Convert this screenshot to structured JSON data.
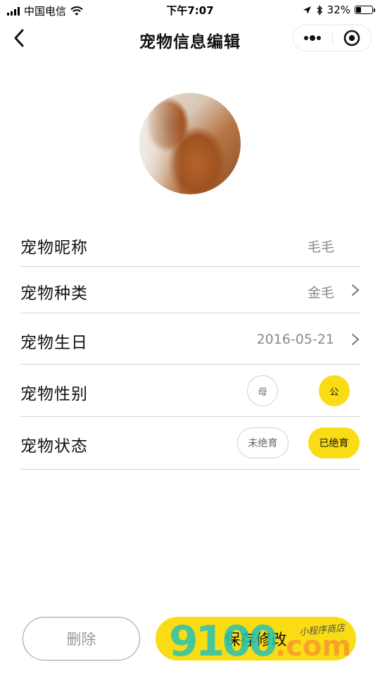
{
  "status_bar": {
    "carrier": "中国电信",
    "time": "下午7:07",
    "battery": "32%",
    "battery_level": 0.32
  },
  "nav": {
    "title": "宠物信息编辑",
    "back_icon": "chevron-left-icon",
    "more_icon": "more-dots-icon",
    "target_icon": "record-icon"
  },
  "form": {
    "nickname": {
      "label": "宠物昵称",
      "value": "毛毛"
    },
    "breed": {
      "label": "宠物种类",
      "value": "金毛"
    },
    "birthday": {
      "label": "宠物生日",
      "value": "2016-05-21"
    },
    "gender": {
      "label": "宠物性别",
      "options": [
        "母",
        "公"
      ],
      "selected": "公"
    },
    "status": {
      "label": "宠物状态",
      "options": [
        "未绝育",
        "已绝育"
      ],
      "selected": "已绝育"
    }
  },
  "actions": {
    "delete": "删除",
    "save": "保存修改"
  },
  "watermark": {
    "main": "9100",
    "suffix": ".com",
    "small": "小程序商店"
  },
  "colors": {
    "accent": "#fadc14",
    "divider": "#d4d4d4",
    "muted": "#8a8a8a"
  }
}
